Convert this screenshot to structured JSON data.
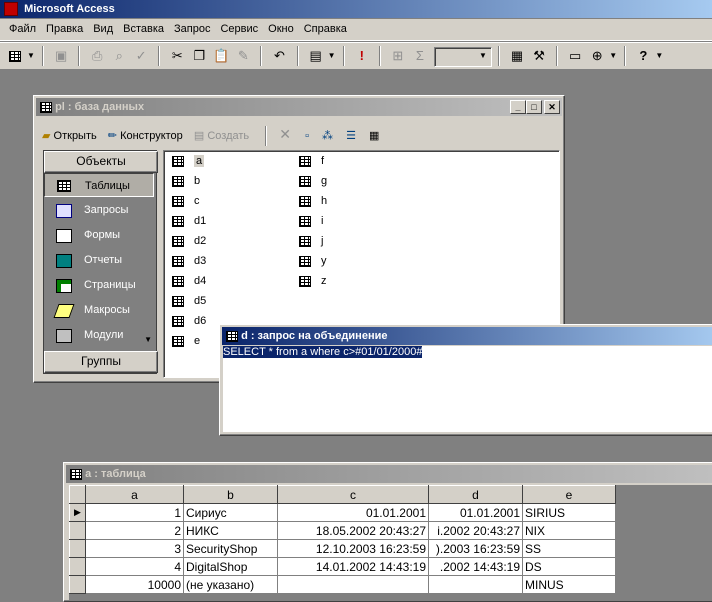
{
  "app": {
    "title": "Microsoft Access"
  },
  "menu": [
    "Файл",
    "Правка",
    "Вид",
    "Вставка",
    "Запрос",
    "Сервис",
    "Окно",
    "Справка"
  ],
  "toolbar": {
    "sigma": "Σ",
    "help": "?"
  },
  "db_window": {
    "title": "pl : база данных",
    "toolbar": {
      "open": "Открыть",
      "design": "Конструктор",
      "create": "Создать"
    },
    "objects_header": "Объекты",
    "groups_header": "Группы",
    "objects": [
      "Таблицы",
      "Запросы",
      "Формы",
      "Отчеты",
      "Страницы",
      "Макросы",
      "Модули"
    ],
    "items_col1": [
      "a",
      "b",
      "c",
      "d1",
      "d2",
      "d3",
      "d4",
      "d5",
      "d6",
      "e"
    ],
    "items_col2": [
      "f",
      "g",
      "h",
      "i",
      "j",
      "y",
      "z"
    ]
  },
  "query_window": {
    "title": "d : запрос на объединение",
    "sql": "SELECT * from a where c>#01/01/2000#"
  },
  "table_window": {
    "title": "a : таблица",
    "columns": [
      "a",
      "b",
      "c",
      "d",
      "e"
    ],
    "rows": [
      [
        "1",
        "Сириус",
        "01.01.2001",
        "01.01.2001",
        "SIRIUS"
      ],
      [
        "2",
        "НИКС",
        "18.05.2002 20:43:27",
        "i.2002 20:43:27",
        "NIX"
      ],
      [
        "3",
        "SecurityShop",
        "12.10.2003 16:23:59",
        ").2003 16:23:59",
        "SS"
      ],
      [
        "4",
        "DigitalShop",
        "14.01.2002 14:43:19",
        ".2002 14:43:19",
        "DS"
      ],
      [
        "10000",
        "(не указано)",
        "",
        "",
        "MINUS"
      ]
    ]
  }
}
